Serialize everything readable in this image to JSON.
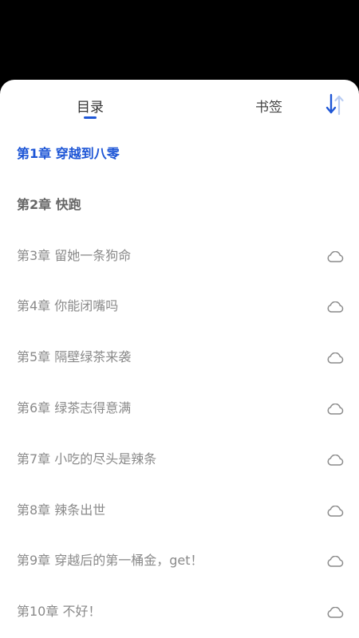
{
  "tabs": {
    "toc_label": "目录",
    "bookmarks_label": "书签"
  },
  "accent_color": "#1e56d6",
  "icons": {
    "sort": "sort-arrows-icon",
    "cloud": "cloud-icon"
  },
  "chapters": [
    {
      "title": "第1章 穿越到八零",
      "state": "current"
    },
    {
      "title": "第2章 快跑",
      "state": "downloaded"
    },
    {
      "title": "第3章 留她一条狗命",
      "state": "cloud"
    },
    {
      "title": "第4章 你能闭嘴吗",
      "state": "cloud"
    },
    {
      "title": "第5章 隔壁绿茶来袭",
      "state": "cloud"
    },
    {
      "title": "第6章 绿茶志得意满",
      "state": "cloud"
    },
    {
      "title": "第7章 小吃的尽头是辣条",
      "state": "cloud"
    },
    {
      "title": "第8章  辣条出世",
      "state": "cloud"
    },
    {
      "title": "第9章 穿越后的第一桶金，get！",
      "state": "cloud"
    },
    {
      "title": "第10章 不好！",
      "state": "cloud"
    }
  ]
}
